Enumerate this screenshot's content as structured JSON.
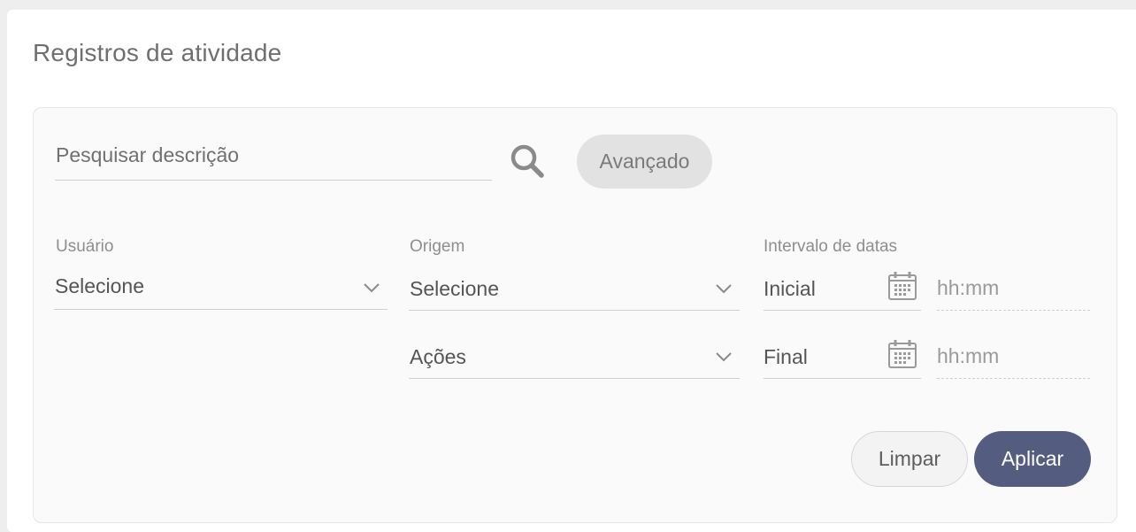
{
  "page": {
    "title": "Registros de atividade"
  },
  "search": {
    "placeholder": "Pesquisar descrição",
    "value": "",
    "advanced_label": "Avançado"
  },
  "filters": {
    "user": {
      "label": "Usuário",
      "value": "Selecione"
    },
    "origin": {
      "label": "Origem",
      "value": "Selecione"
    },
    "actions": {
      "value": "Ações"
    },
    "date_range": {
      "label": "Intervalo de datas",
      "start": {
        "value": "Inicial",
        "time_placeholder": "hh:mm"
      },
      "end": {
        "value": "Final",
        "time_placeholder": "hh:mm"
      }
    }
  },
  "buttons": {
    "clear": "Limpar",
    "apply": "Aplicar"
  },
  "icons": {
    "search": "search-icon",
    "chevron": "chevron-down-icon",
    "calendar": "calendar-icon"
  },
  "colors": {
    "primary": "#545d80",
    "panel": "#fafafa"
  }
}
